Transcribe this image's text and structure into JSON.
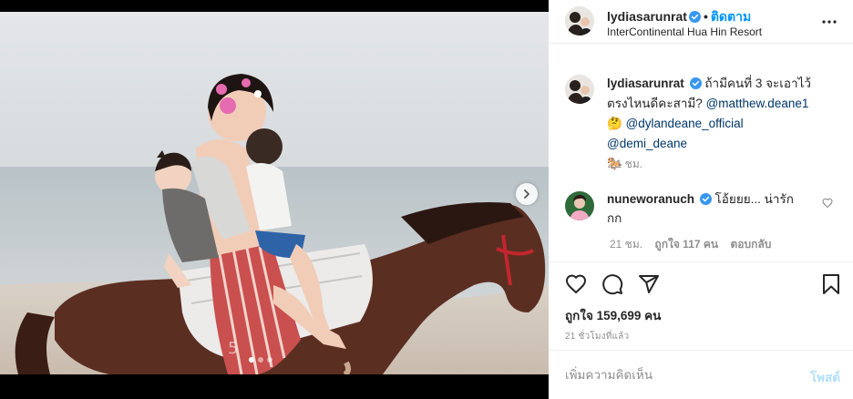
{
  "post": {
    "username": "lydiasarunrat",
    "follow_label": "ติดตาม",
    "separator": "•",
    "location": "InterContinental Hua Hin Resort"
  },
  "caption": {
    "username": "lydiasarunrat",
    "text_1": "ถ้ามีคนที่ 3 จะเอาไว้ตรงไหนดีคะสามี?",
    "mention_1": "@matthew.deane1",
    "emoji_1": "🤔",
    "mention_2": "@dylandeane_official",
    "mention_3": "@demi_deane",
    "emoji_2": "🐎",
    "time": "21 ชม."
  },
  "comments": [
    {
      "username": "nuneworanuch",
      "text": "โอ้ยยย... น่ารักกก",
      "time": "21 ชม.",
      "likes": "ถูกใจ 117 คน",
      "reply_label": "ตอบกลับ"
    }
  ],
  "stats": {
    "likes": "ถูกใจ 159,699 คน",
    "time_ago": "21 ชั่วโมงที่แล้ว"
  },
  "comment_box": {
    "placeholder": "เพิ่มความคิดเห็น",
    "post_label": "โพสต์"
  },
  "carousel": {
    "total": 3,
    "active_index": 0
  },
  "colors": {
    "accent": "#0095f6",
    "verified": "#3897f0",
    "mention": "#00376b",
    "muted": "#8e8e8e",
    "post_disabled": "#b2dffc"
  },
  "icons": [
    "next-arrow-icon",
    "verified-badge-icon",
    "more-options-icon",
    "heart-icon",
    "comment-icon",
    "share-icon",
    "bookmark-icon"
  ]
}
